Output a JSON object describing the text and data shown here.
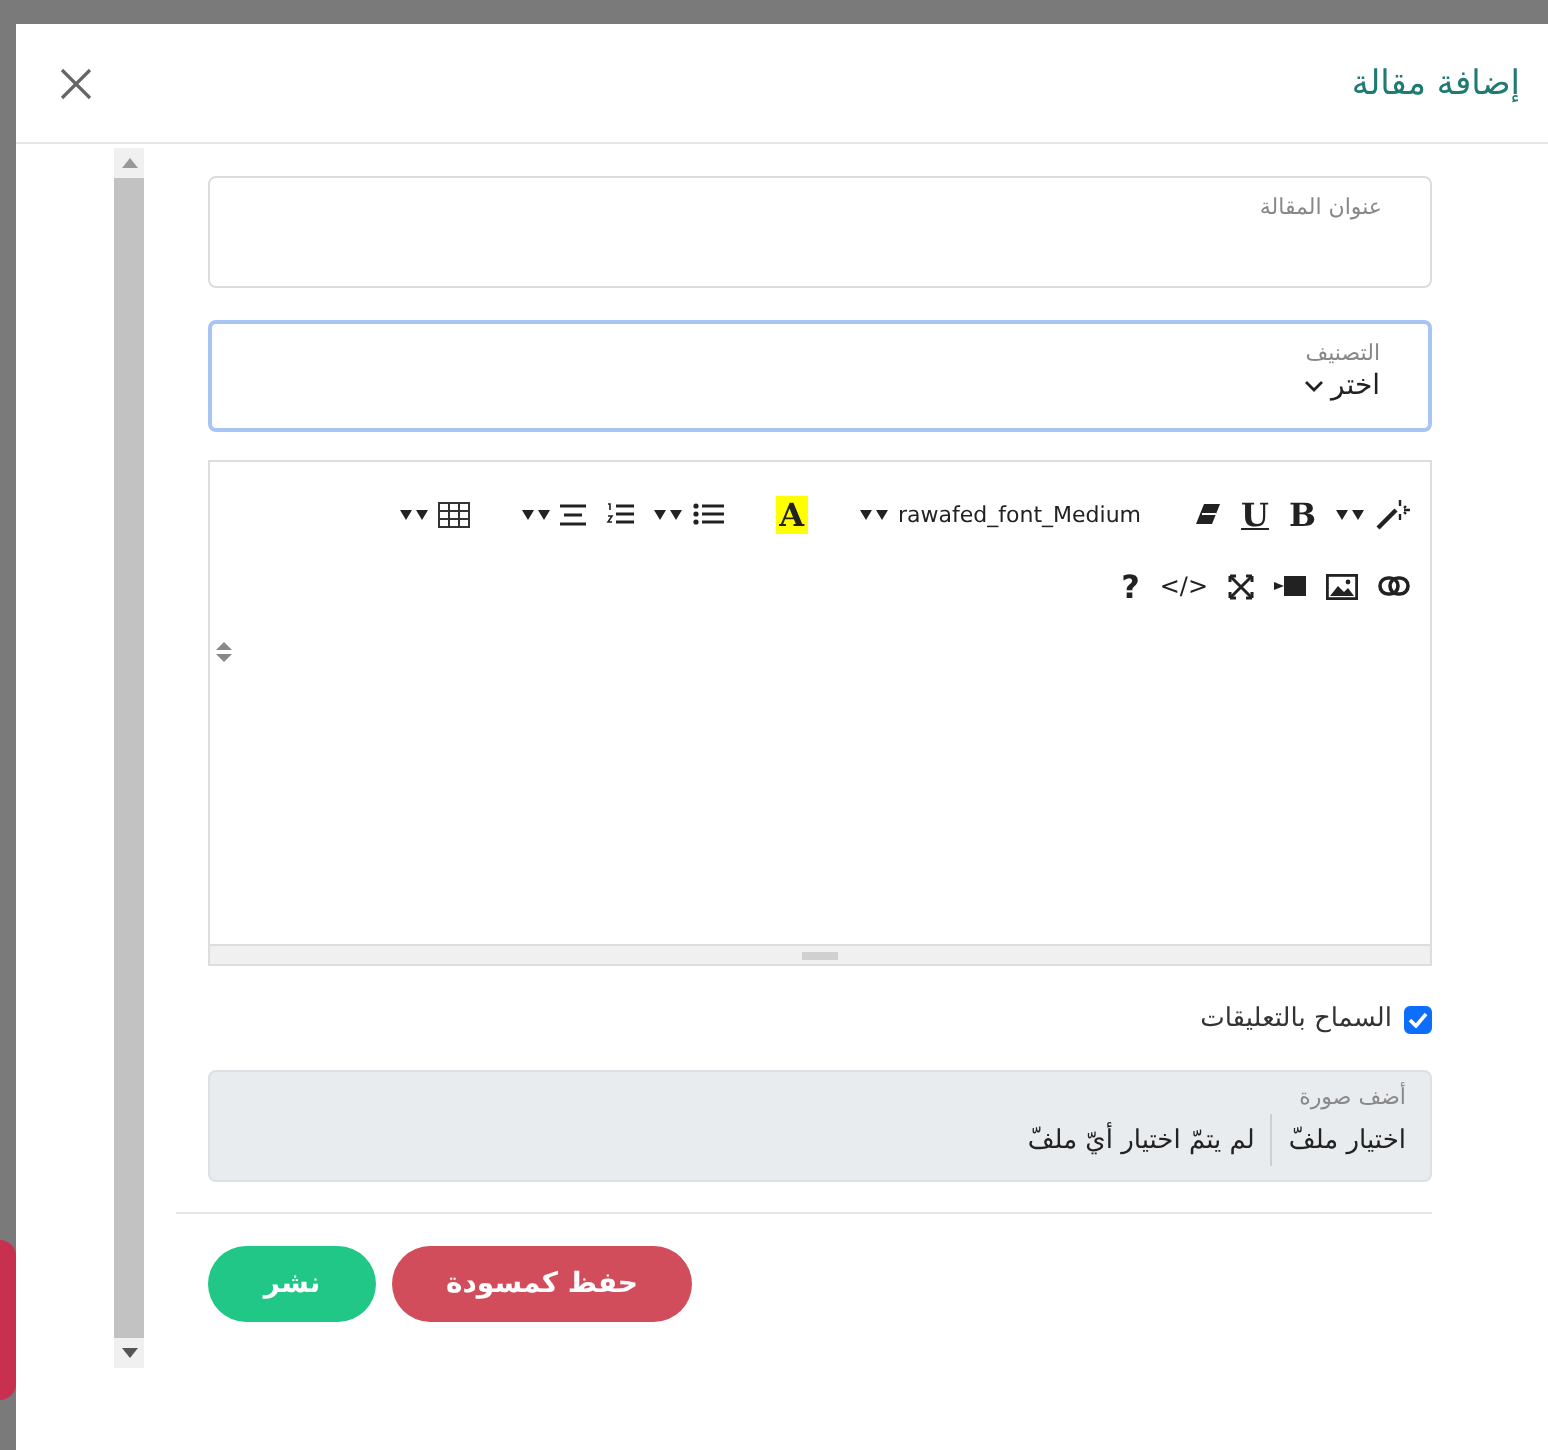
{
  "modal": {
    "title": "إضافة مقالة"
  },
  "fields": [
    {
      "kind": "text",
      "label": "عنوان المقالة",
      "focused": false
    },
    {
      "kind": "select",
      "label": "التصنيف",
      "value": "اختر",
      "focused": true
    }
  ],
  "editor": {
    "toolbar": [
      [
        [
          {
            "kind": "wand",
            "dropdown": true
          },
          {
            "kind": "bold",
            "text": "B",
            "dropdown": false
          },
          {
            "kind": "underline",
            "text": "U",
            "dropdown": false
          },
          {
            "kind": "eraser",
            "dropdown": false
          }
        ],
        [
          {
            "kind": "font",
            "text": "rawafed_font_Medium",
            "dropdown": true
          }
        ],
        [
          {
            "kind": "highlight",
            "text": "A",
            "dropdown": false
          }
        ],
        [
          {
            "kind": "ul",
            "dropdown": true
          },
          {
            "kind": "ol",
            "dropdown": false
          },
          {
            "kind": "align",
            "dropdown": true
          }
        ],
        [
          {
            "kind": "table",
            "dropdown": true
          }
        ]
      ],
      [
        [
          {
            "kind": "link",
            "dropdown": false
          },
          {
            "kind": "image",
            "dropdown": false
          },
          {
            "kind": "video",
            "dropdown": false
          },
          {
            "kind": "fullscreen",
            "dropdown": false
          },
          {
            "kind": "code",
            "text": "</>",
            "dropdown": false
          },
          {
            "kind": "help",
            "text": "?",
            "dropdown": false
          }
        ]
      ]
    ]
  },
  "comments": {
    "label": "السماح بالتعليقات",
    "checked": true
  },
  "image_upload": {
    "label": "أضف صورة",
    "button": "اختيار ملفّ",
    "status": "لم يتمّ اختيار أيّ ملفّ"
  },
  "buttons": [
    {
      "kind": "danger",
      "label": "حفظ كمسودة"
    },
    {
      "kind": "primary",
      "label": "نشر"
    }
  ]
}
